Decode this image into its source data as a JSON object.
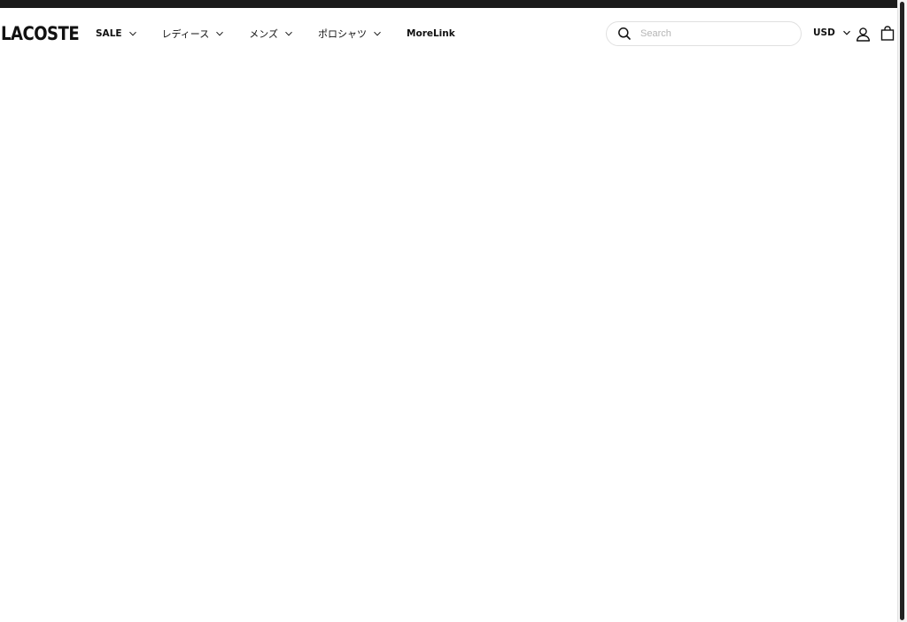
{
  "brand": {
    "logo_text": "LACOSTE"
  },
  "nav": {
    "items": [
      {
        "label": "SALE",
        "has_dropdown": true,
        "icon": "chevron-down-icon"
      },
      {
        "label": "レディース",
        "has_dropdown": true,
        "icon": "chevron-down-icon"
      },
      {
        "label": "メンズ",
        "has_dropdown": true,
        "icon": "chevron-down-icon"
      },
      {
        "label": "ポロシャツ",
        "has_dropdown": true,
        "icon": "chevron-down-icon"
      },
      {
        "label": "MoreLink",
        "has_dropdown": false
      }
    ]
  },
  "search": {
    "placeholder": "Search",
    "value": "",
    "icon": "search-icon"
  },
  "currency": {
    "label": "USD",
    "icon": "chevron-down-icon"
  },
  "header_icons": {
    "account": "user-icon",
    "cart": "shopping-bag-icon"
  },
  "colors": {
    "top_strip": "#1b1b1b",
    "text": "#111111",
    "search_border": "#e0e0e0",
    "placeholder": "#b5b5b5"
  }
}
